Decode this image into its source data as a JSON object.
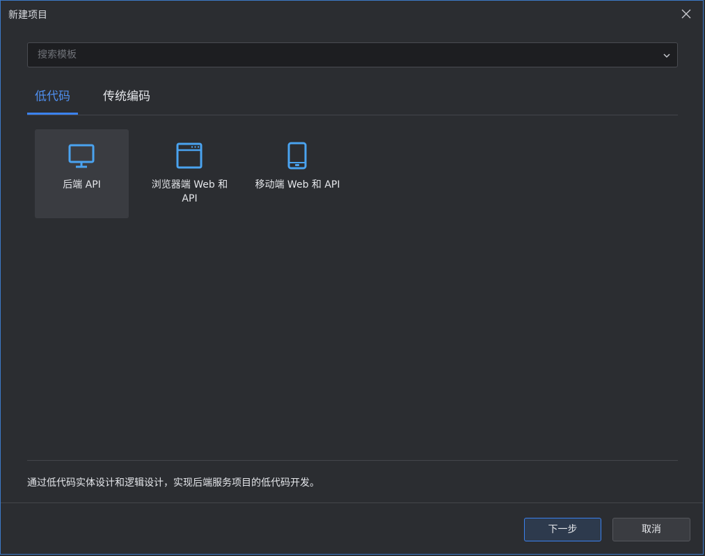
{
  "dialog": {
    "title": "新建项目"
  },
  "search": {
    "placeholder": "搜索模板",
    "value": ""
  },
  "tabs": [
    {
      "label": "低代码",
      "active": true
    },
    {
      "label": "传统编码",
      "active": false
    }
  ],
  "templates": [
    {
      "label": "后端 API",
      "icon": "monitor-icon",
      "selected": true
    },
    {
      "label": "浏览器端 Web 和 API",
      "icon": "browser-window-icon",
      "selected": false
    },
    {
      "label": "移动端 Web 和 API",
      "icon": "mobile-phone-icon",
      "selected": false
    }
  ],
  "description": "通过低代码实体设计和逻辑设计，实现后端服务项目的低代码开发。",
  "footer": {
    "next_label": "下一步",
    "cancel_label": "取消"
  },
  "colors": {
    "accent": "#3b82f0",
    "icon": "#4aa3f0",
    "background": "#2b2d31"
  }
}
